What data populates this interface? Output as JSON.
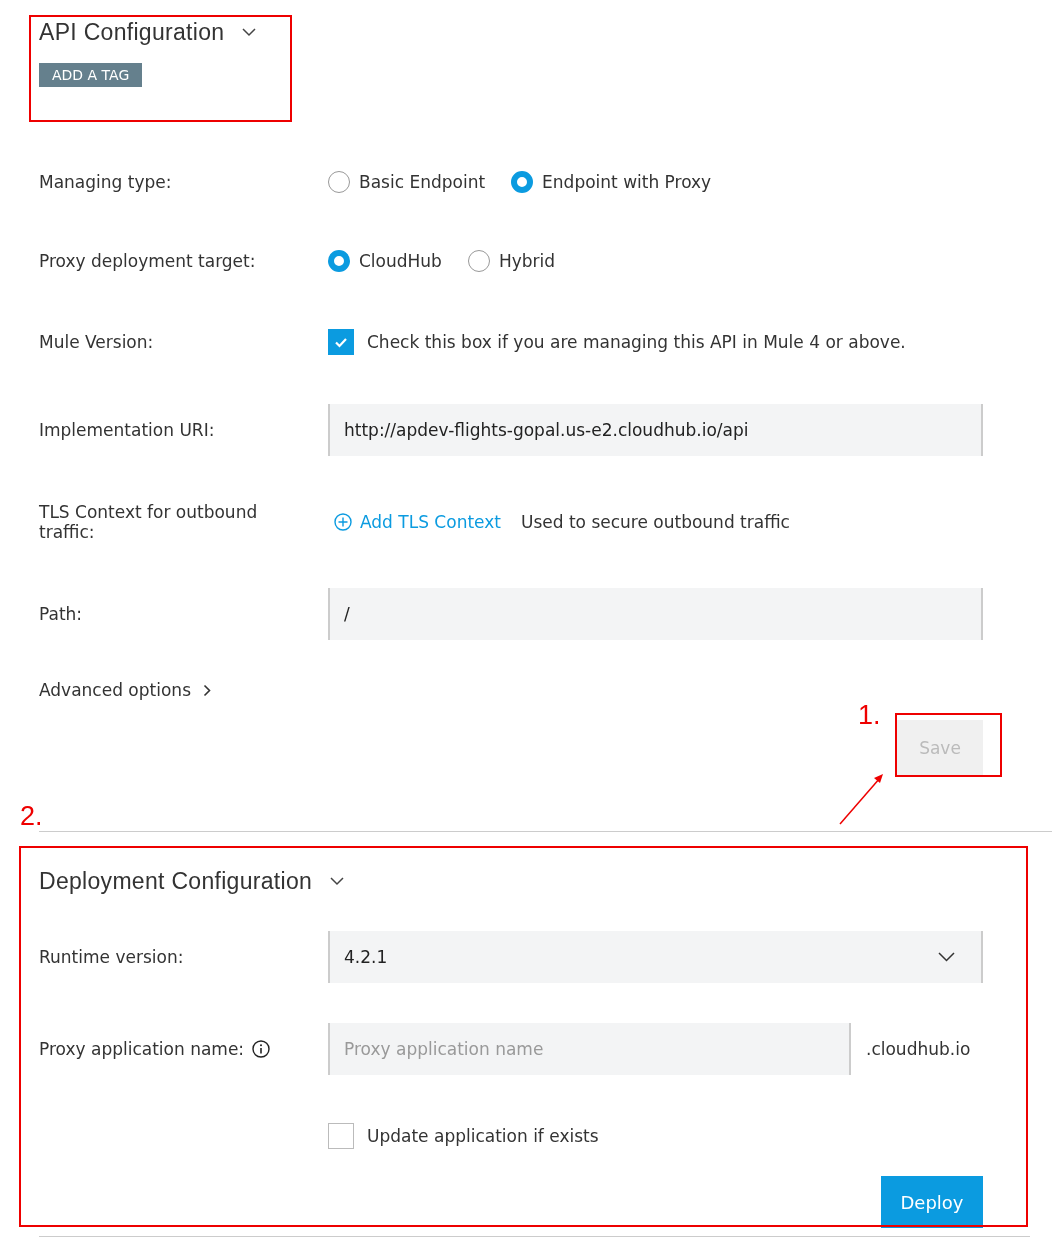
{
  "api_configuration": {
    "title": "API Configuration",
    "tag_button": "ADD A TAG"
  },
  "form": [
    {
      "kind": "radio",
      "label": "Managing type:",
      "options": [
        {
          "label": "Basic Endpoint",
          "selected": false
        },
        {
          "label": "Endpoint with Proxy",
          "selected": true
        }
      ]
    },
    {
      "kind": "radio",
      "label": "Proxy deployment target:",
      "options": [
        {
          "label": "CloudHub",
          "selected": true
        },
        {
          "label": "Hybrid",
          "selected": false
        }
      ]
    },
    {
      "kind": "checkbox",
      "label": "Mule Version:",
      "text": "Check this box if you are managing this API in Mule 4 or above.",
      "checked": true
    },
    {
      "kind": "input",
      "label": "Implementation URI:",
      "value": "http://apdev-flights-gopal.us-e2.cloudhub.io/api"
    },
    {
      "kind": "link",
      "label": "TLS Context for outbound traffic:",
      "link": "Add TLS Context",
      "note": "Used to secure outbound traffic"
    },
    {
      "kind": "input",
      "label": "Path:",
      "value": "/"
    }
  ],
  "advanced_options": "Advanced options",
  "save_button": {
    "label": "Save",
    "disabled": true
  },
  "deployment_configuration": {
    "title": "Deployment Configuration",
    "runtime_version": {
      "label": "Runtime version:",
      "value": "4.2.1"
    },
    "proxy_application_name": {
      "label": "Proxy application name:",
      "placeholder": "Proxy application name",
      "suffix": ".cloudhub.io"
    },
    "update_checkbox": {
      "label": "Update application if exists",
      "checked": false
    },
    "deploy_button": "Deploy"
  },
  "annotations": [
    {
      "text": "1."
    },
    {
      "text": "2."
    }
  ]
}
